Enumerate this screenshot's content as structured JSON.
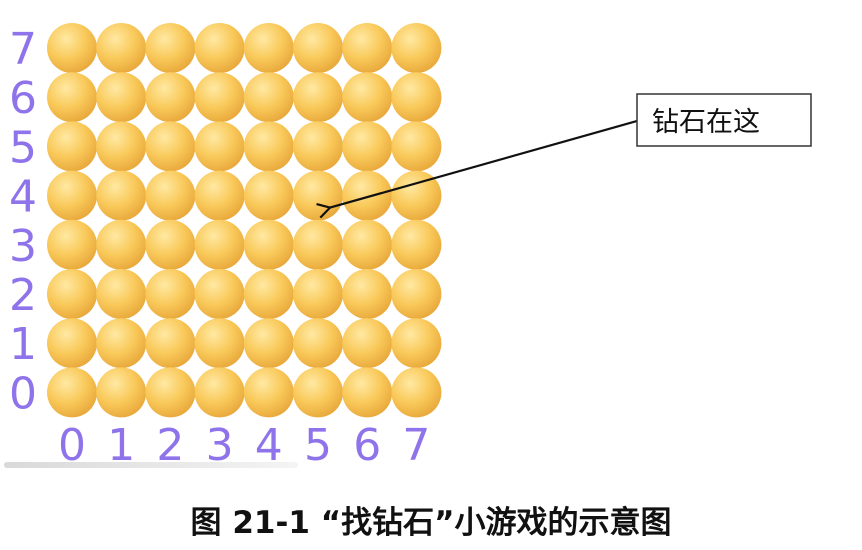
{
  "grid": {
    "rows": 8,
    "cols": 8,
    "y_labels": [
      "7",
      "6",
      "5",
      "4",
      "3",
      "2",
      "1",
      "0"
    ],
    "x_labels": [
      "0",
      "1",
      "2",
      "3",
      "4",
      "5",
      "6",
      "7"
    ],
    "label_color": "#8f73ea",
    "ball_colors": {
      "light": "#ffe9a3",
      "mid": "#f9c95a",
      "dark": "#e8a73a"
    }
  },
  "callout": {
    "text": "钻石在这",
    "target": {
      "col": 5,
      "row": 4
    }
  },
  "caption": {
    "text": "图 21-1  “找钻石”小游戏的示意图"
  }
}
